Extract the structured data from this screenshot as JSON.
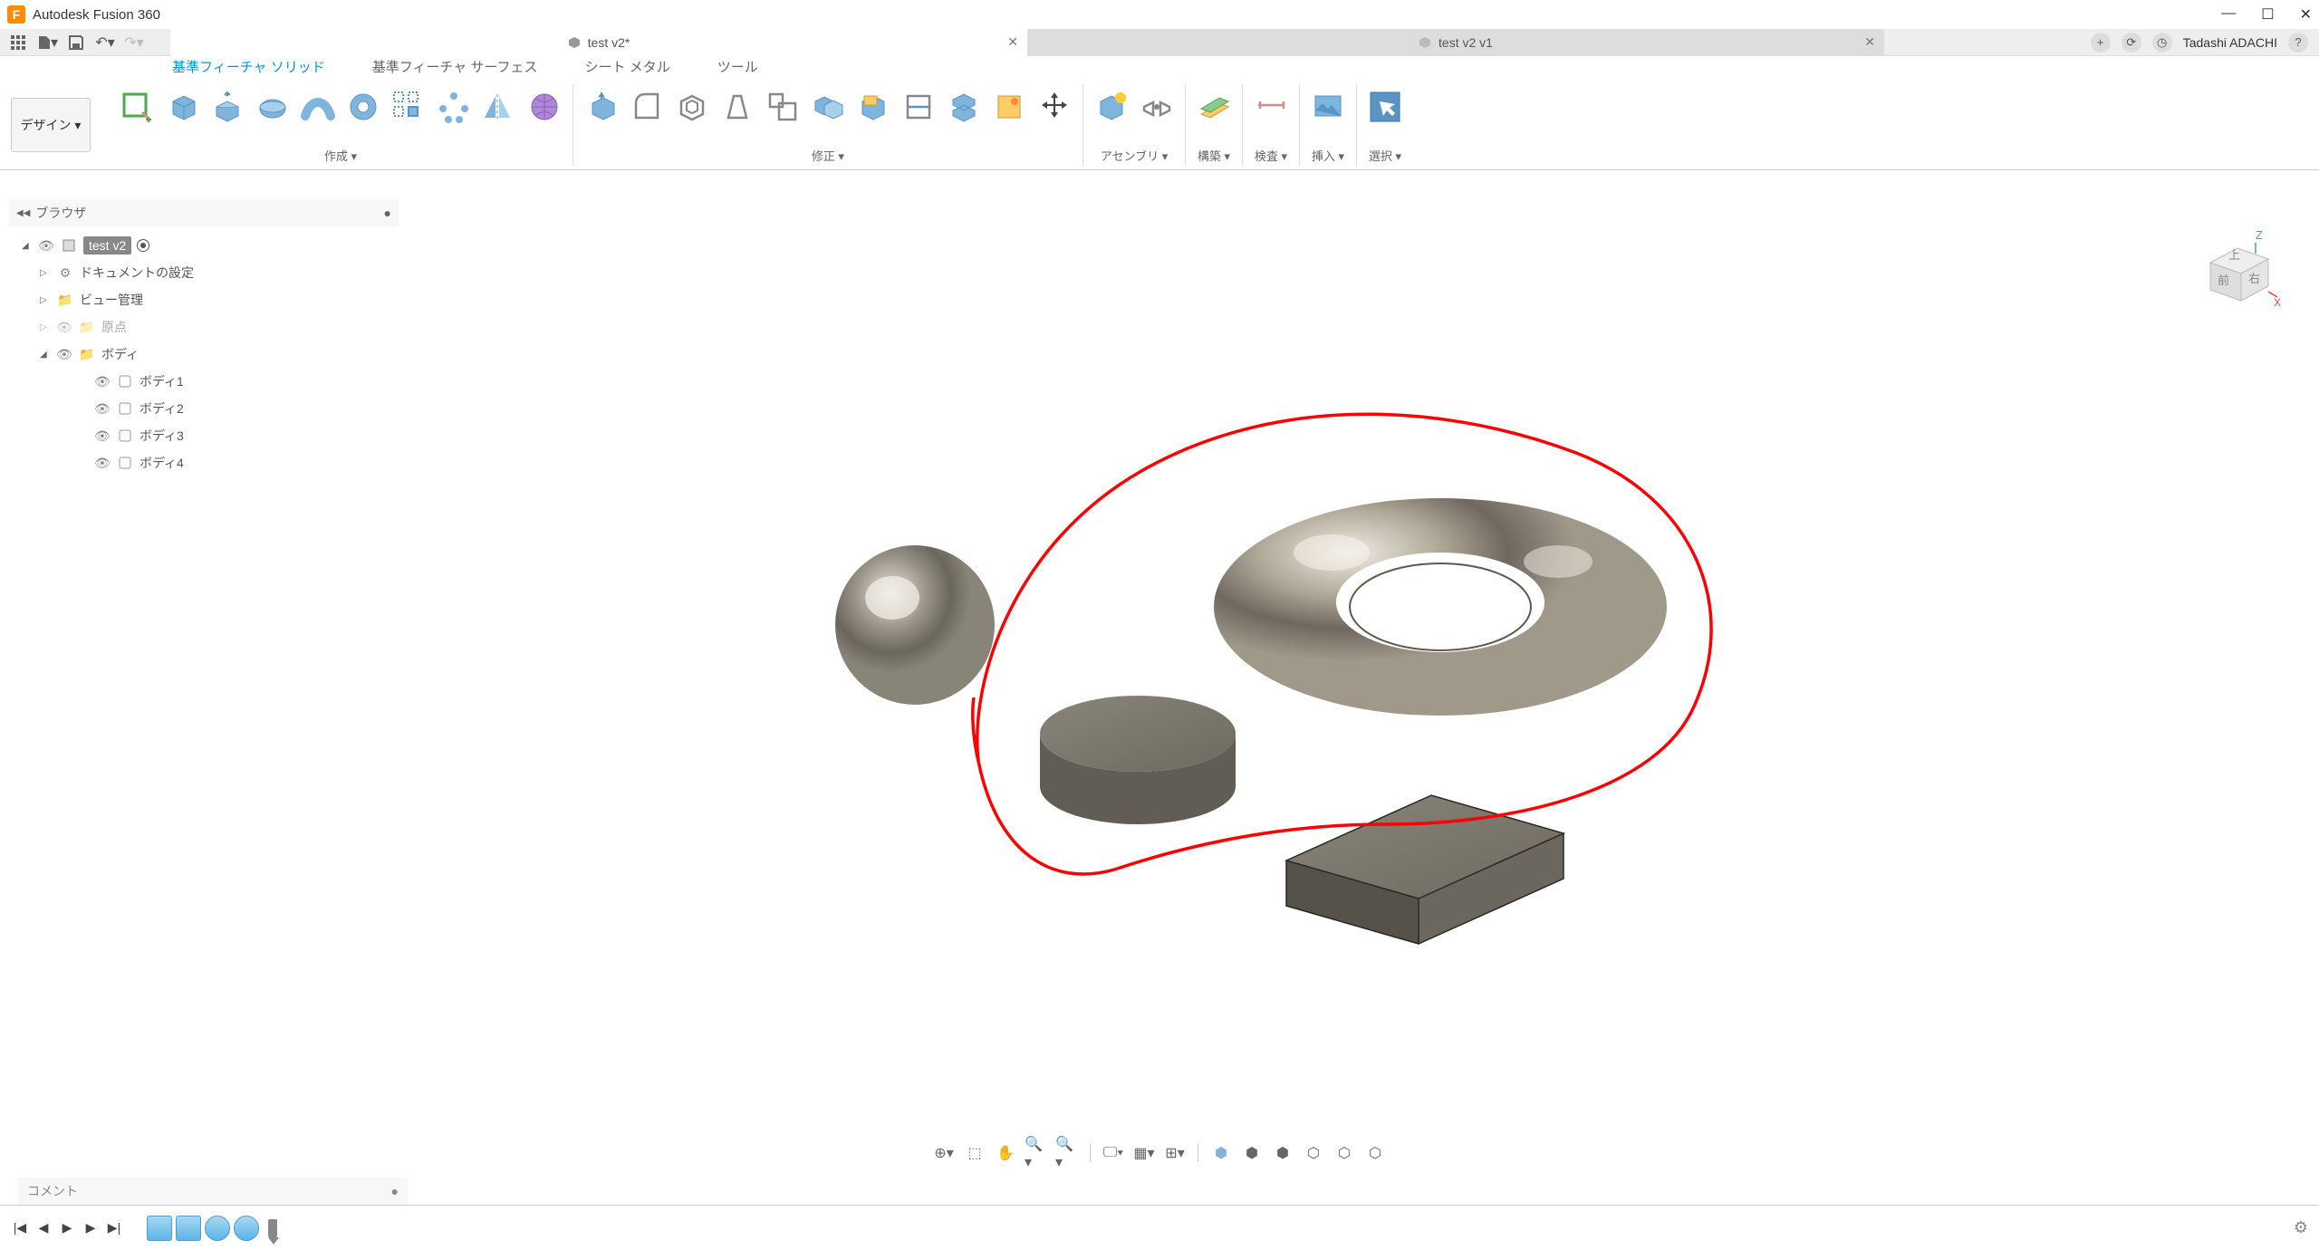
{
  "app": {
    "title": "Autodesk Fusion 360",
    "icon_letter": "F",
    "user": "Tadashi ADACHI"
  },
  "window_buttons": {
    "min": "—",
    "max": "☐",
    "close": "✕"
  },
  "quick_access": {
    "grid": "▦",
    "file": "▾",
    "save": "💾",
    "undo": "↶",
    "redo": "↷"
  },
  "doc_tabs": [
    {
      "label": "test v2*",
      "active": true
    },
    {
      "label": "test v2 v1",
      "active": false
    }
  ],
  "top_right": {
    "plus": "+",
    "job": "⟳",
    "ext": "◷",
    "help": "?"
  },
  "ribbon_tabs": [
    {
      "label": "基準フィーチャ ソリッド",
      "active": true
    },
    {
      "label": "基準フィーチャ サーフェス",
      "active": false
    },
    {
      "label": "シート メタル",
      "active": false
    },
    {
      "label": "ツール",
      "active": false
    }
  ],
  "workspace": {
    "label": "デザイン ▾"
  },
  "ribbon_panels": {
    "create": "作成 ▾",
    "modify": "修正 ▾",
    "assemble": "アセンブリ ▾",
    "construct": "構築 ▾",
    "inspect": "検査 ▾",
    "insert": "挿入 ▾",
    "select": "選択 ▾"
  },
  "browser": {
    "title": "ブラウザ",
    "root": "test v2",
    "nodes": [
      {
        "label": "ドキュメントの設定",
        "icon": "gear",
        "indent": 1,
        "expand": "▷"
      },
      {
        "label": "ビュー管理",
        "icon": "folder",
        "indent": 1,
        "expand": "▷"
      },
      {
        "label": "原点",
        "icon": "folder-dim",
        "indent": 1,
        "expand": "▷",
        "dim": true
      },
      {
        "label": "ボディ",
        "icon": "folder",
        "indent": 1,
        "expand": "◢"
      },
      {
        "label": "ボディ1",
        "icon": "body",
        "indent": 2
      },
      {
        "label": "ボディ2",
        "icon": "body",
        "indent": 2
      },
      {
        "label": "ボディ3",
        "icon": "body",
        "indent": 2
      },
      {
        "label": "ボディ4",
        "icon": "body",
        "indent": 2
      }
    ]
  },
  "viewcube": {
    "top": "上",
    "front": "前",
    "right": "右",
    "z": "Z",
    "x": "X"
  },
  "comment_bar": {
    "label": "コメント"
  },
  "timeline": {
    "feature_count": 4
  },
  "colors": {
    "accent": "#0696D7",
    "annotation": "#ff0000"
  }
}
